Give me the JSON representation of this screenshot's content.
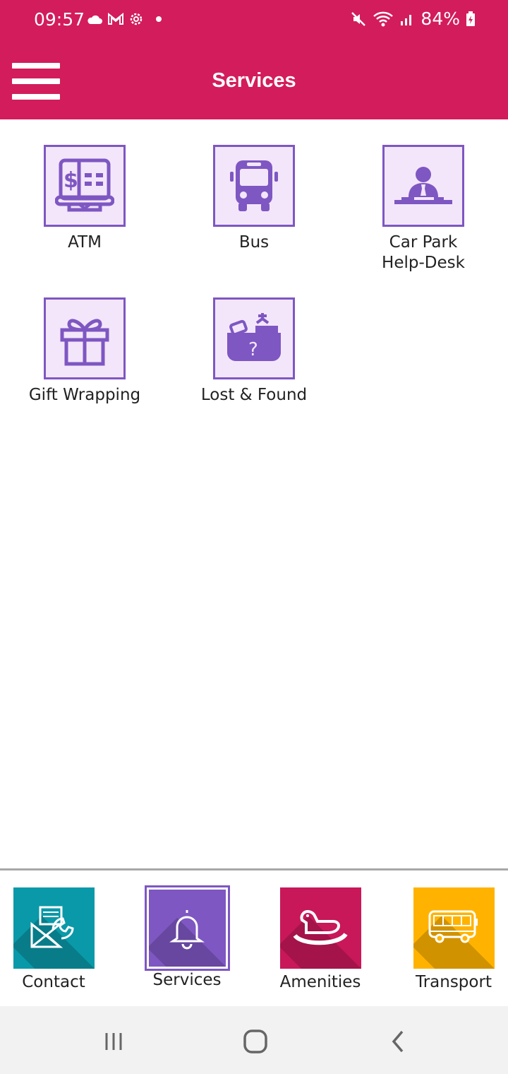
{
  "status_bar": {
    "time": "09:57",
    "battery_percent": "84%",
    "icons_left": [
      "cloud-icon",
      "gmail-icon",
      "settings-icon",
      "dot-icon"
    ],
    "icons_right": [
      "mute-icon",
      "wifi-icon",
      "signal-icon",
      "battery-charging-icon"
    ]
  },
  "app_bar": {
    "title": "Services",
    "menu_icon": "hamburger-menu-icon"
  },
  "services": [
    {
      "label": "ATM",
      "icon": "atm-icon"
    },
    {
      "label": "Bus",
      "icon": "bus-icon"
    },
    {
      "label": "Car Park Help-Desk",
      "label_line1": "Car Park",
      "label_line2": "Help-Desk",
      "icon": "help-desk-icon"
    },
    {
      "label": "Gift Wrapping",
      "icon": "gift-icon"
    },
    {
      "label": "Lost & Found",
      "icon": "lost-found-icon"
    }
  ],
  "bottom_nav": [
    {
      "label": "Contact",
      "icon": "contact-icon",
      "color": "#0a99a8",
      "active": false
    },
    {
      "label": "Services",
      "icon": "bell-icon",
      "color": "#7e57c2",
      "active": true
    },
    {
      "label": "Amenities",
      "icon": "rocking-horse-icon",
      "color": "#c8185a",
      "active": false
    },
    {
      "label": "Transport",
      "icon": "bus-icon",
      "color": "#ffb300",
      "active": false
    }
  ],
  "system_nav": [
    "recent-apps-icon",
    "home-icon",
    "back-icon"
  ],
  "colors": {
    "primary": "#d31c5b",
    "tile_border": "#7e57c2",
    "tile_bg": "#f3e6fb"
  }
}
